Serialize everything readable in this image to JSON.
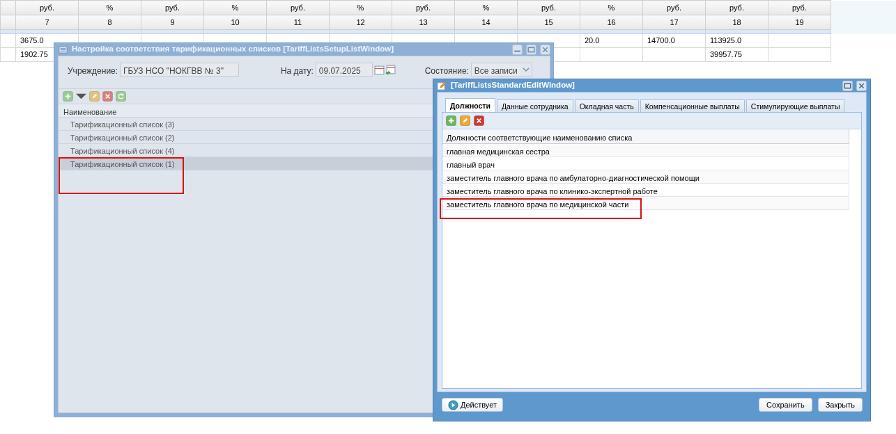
{
  "background_table": {
    "units": [
      "руб.",
      "%",
      "руб.",
      "%",
      "руб.",
      "%",
      "руб.",
      "%",
      "руб.",
      "%",
      "руб.",
      "руб.",
      "руб."
    ],
    "numbers": [
      "7",
      "8",
      "9",
      "10",
      "11",
      "12",
      "13",
      "14",
      "15",
      "16",
      "17",
      "18",
      "19"
    ],
    "rows": [
      [
        "3675.0",
        null,
        null,
        null,
        null,
        null,
        null,
        null,
        null,
        "20.0",
        "14700.0",
        "113925.0",
        null
      ],
      [
        "1902.75",
        null,
        null,
        null,
        null,
        null,
        null,
        null,
        null,
        null,
        null,
        "39957.75",
        null
      ]
    ]
  },
  "setup_window": {
    "title": "Настройка соответствия тарификационных списков [TariffListsSetupListWindow]",
    "institution_label": "Учреждение:",
    "institution_value": "ГБУЗ НСО \"НОКГВВ № 3\"",
    "date_label": "На дату:",
    "date_value": "09.07.2025",
    "state_label": "Состояние:",
    "state_value": "Все записи",
    "column": "Наименование",
    "rows": [
      {
        "name": "Тарификационный список (3)",
        "selected": false,
        "highlighted": false
      },
      {
        "name": "Тарификационный список (2)",
        "selected": false,
        "highlighted": false
      },
      {
        "name": "Тарификационный список (4)",
        "selected": false,
        "highlighted": false
      },
      {
        "name": "Тарификационный список (1)",
        "selected": true,
        "highlighted": true
      }
    ]
  },
  "edit_window": {
    "title": "[TariffListsStandardEditWindow]",
    "tabs": [
      {
        "label": "Должности",
        "selected": true
      },
      {
        "label": "Данные сотрудника",
        "selected": false
      },
      {
        "label": "Окладная часть",
        "selected": false
      },
      {
        "label": "Компенсационные выплаты",
        "selected": false
      },
      {
        "label": "Стимулирующие выплаты",
        "selected": false
      }
    ],
    "column": "Должности соответствующие наименованию списка",
    "rows": [
      {
        "name": "главная медицинская сестра",
        "highlighted": false
      },
      {
        "name": "главный врач",
        "highlighted": false
      },
      {
        "name": "заместитель главного врача по амбулаторно-диагностической помощи",
        "highlighted": false
      },
      {
        "name": "заместитель главного врача по клинико-экспертной работе",
        "highlighted": false
      },
      {
        "name": "заместитель главного врача по медицинской части",
        "highlighted": true
      }
    ],
    "status_button": "Действует",
    "buttons": [
      "Сохранить",
      "Закрыть"
    ]
  }
}
